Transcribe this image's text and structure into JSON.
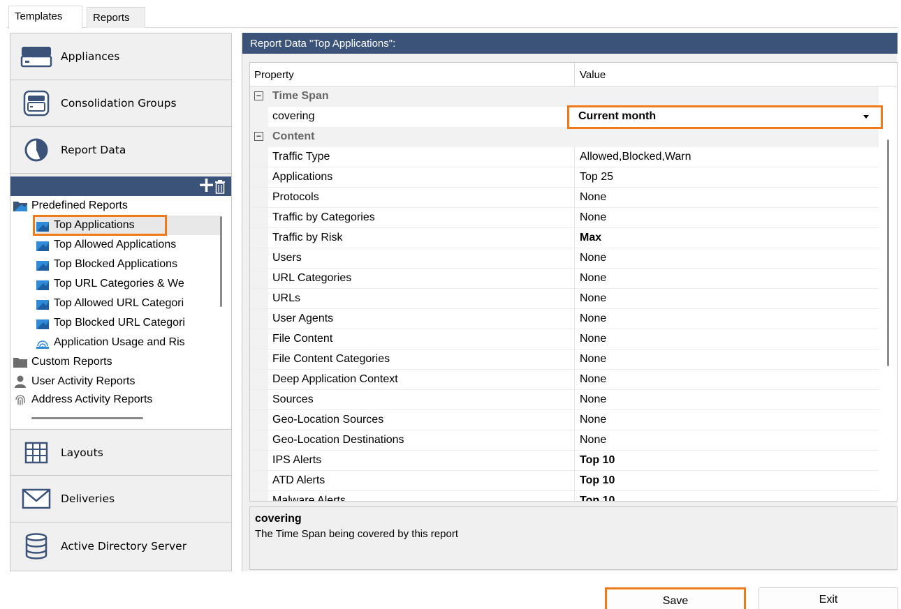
{
  "tabs": [
    {
      "label": "Templates",
      "active": true
    },
    {
      "label": "Reports",
      "active": false
    }
  ],
  "nav": {
    "appliances": "Appliances",
    "consolidation_groups": "Consolidation Groups",
    "report_data": "Report Data",
    "layouts": "Layouts",
    "deliveries": "Deliveries",
    "active_directory": "Active Directory Server"
  },
  "tree": {
    "predefined": "Predefined Reports",
    "items": [
      "Top Applications",
      "Top Allowed Applications",
      "Top Blocked Applications",
      "Top URL Categories & We",
      "Top Allowed URL Categori",
      "Top Blocked URL Categori",
      "Application Usage and Ris"
    ],
    "custom": "Custom Reports",
    "user_activity": "User Activity Reports",
    "address_activity": "Address Activity Reports"
  },
  "panel_title": "Report Data \"Top Applications\":",
  "grid": {
    "col_property": "Property",
    "col_value": "Value",
    "time_span": "Time Span",
    "covering_label": "covering",
    "covering_value": "Current month",
    "content": "Content",
    "rows": [
      {
        "p": "Traffic Type",
        "v": "Allowed,Blocked,Warn",
        "bold": false
      },
      {
        "p": "Applications",
        "v": "Top 25",
        "bold": false
      },
      {
        "p": "Protocols",
        "v": "None",
        "bold": false
      },
      {
        "p": "Traffic by Categories",
        "v": "None",
        "bold": false
      },
      {
        "p": "Traffic by Risk",
        "v": "Max",
        "bold": true
      },
      {
        "p": "Users",
        "v": "None",
        "bold": false
      },
      {
        "p": "URL Categories",
        "v": "None",
        "bold": false
      },
      {
        "p": "URLs",
        "v": "None",
        "bold": false
      },
      {
        "p": "User Agents",
        "v": "None",
        "bold": false
      },
      {
        "p": "File Content",
        "v": "None",
        "bold": false
      },
      {
        "p": "File Content Categories",
        "v": "None",
        "bold": false
      },
      {
        "p": "Deep Application Context",
        "v": "None",
        "bold": false
      },
      {
        "p": "Sources",
        "v": "None",
        "bold": false
      },
      {
        "p": "Geo-Location Sources",
        "v": "None",
        "bold": false
      },
      {
        "p": "Geo-Location Destinations",
        "v": "None",
        "bold": false
      },
      {
        "p": "IPS Alerts",
        "v": "Top 10",
        "bold": true
      },
      {
        "p": "ATD Alerts",
        "v": "Top 10",
        "bold": true
      },
      {
        "p": "Malware Alerts",
        "v": "Top 10",
        "bold": true
      }
    ]
  },
  "description": {
    "title": "covering",
    "text": "The Time Span being covered by this report"
  },
  "buttons": {
    "save": "Save",
    "exit": "Exit"
  },
  "colors": {
    "header_blue": "#3c5379",
    "highlight_orange": "#f07a1a",
    "icon_blue": "#2f6fa8",
    "icon_dark": "#3c5379"
  }
}
